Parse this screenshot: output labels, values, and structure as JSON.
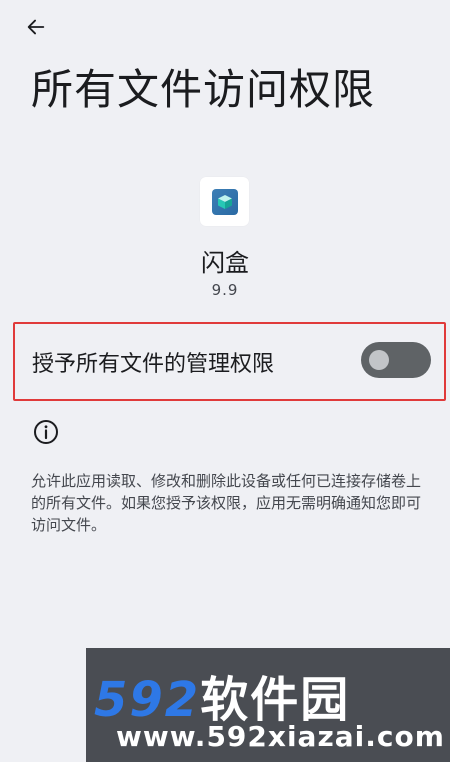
{
  "header": {
    "back_icon": "arrow-left-icon",
    "title": "所有文件访问权限"
  },
  "app": {
    "icon": "box-app-icon",
    "name": "闪盒",
    "version": "9.9"
  },
  "permission": {
    "label": "授予所有文件的管理权限",
    "enabled": false
  },
  "info": {
    "icon": "info-icon",
    "description": "允许此应用读取、修改和删除此设备或任何已连接存储卷上的所有文件。如果您授予该权限，应用无需明确通知您即可访问文件。"
  },
  "watermark": {
    "number": "592",
    "text": "软件园",
    "url": "www.592xiazai.com"
  },
  "colors": {
    "background": "#eff0f4",
    "toggle_track": "#5f6366",
    "highlight_border": "#e03a3a",
    "watermark_blue": "#2e78e6"
  }
}
